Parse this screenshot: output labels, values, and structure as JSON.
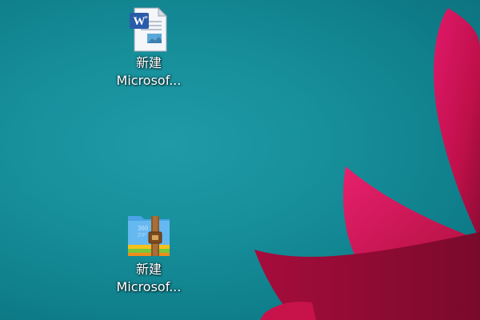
{
  "desktop": {
    "colors": {
      "background": "#138c98",
      "petal": "#c8124a",
      "petal_dark": "#9e0e3a"
    },
    "icons": [
      {
        "name_line1": "新建",
        "name_line2": "Microsof...",
        "icon": "word-document-icon"
      },
      {
        "name_line1": "新建",
        "name_line2": "Microsof...",
        "icon": "360zip-archive-icon"
      }
    ]
  }
}
